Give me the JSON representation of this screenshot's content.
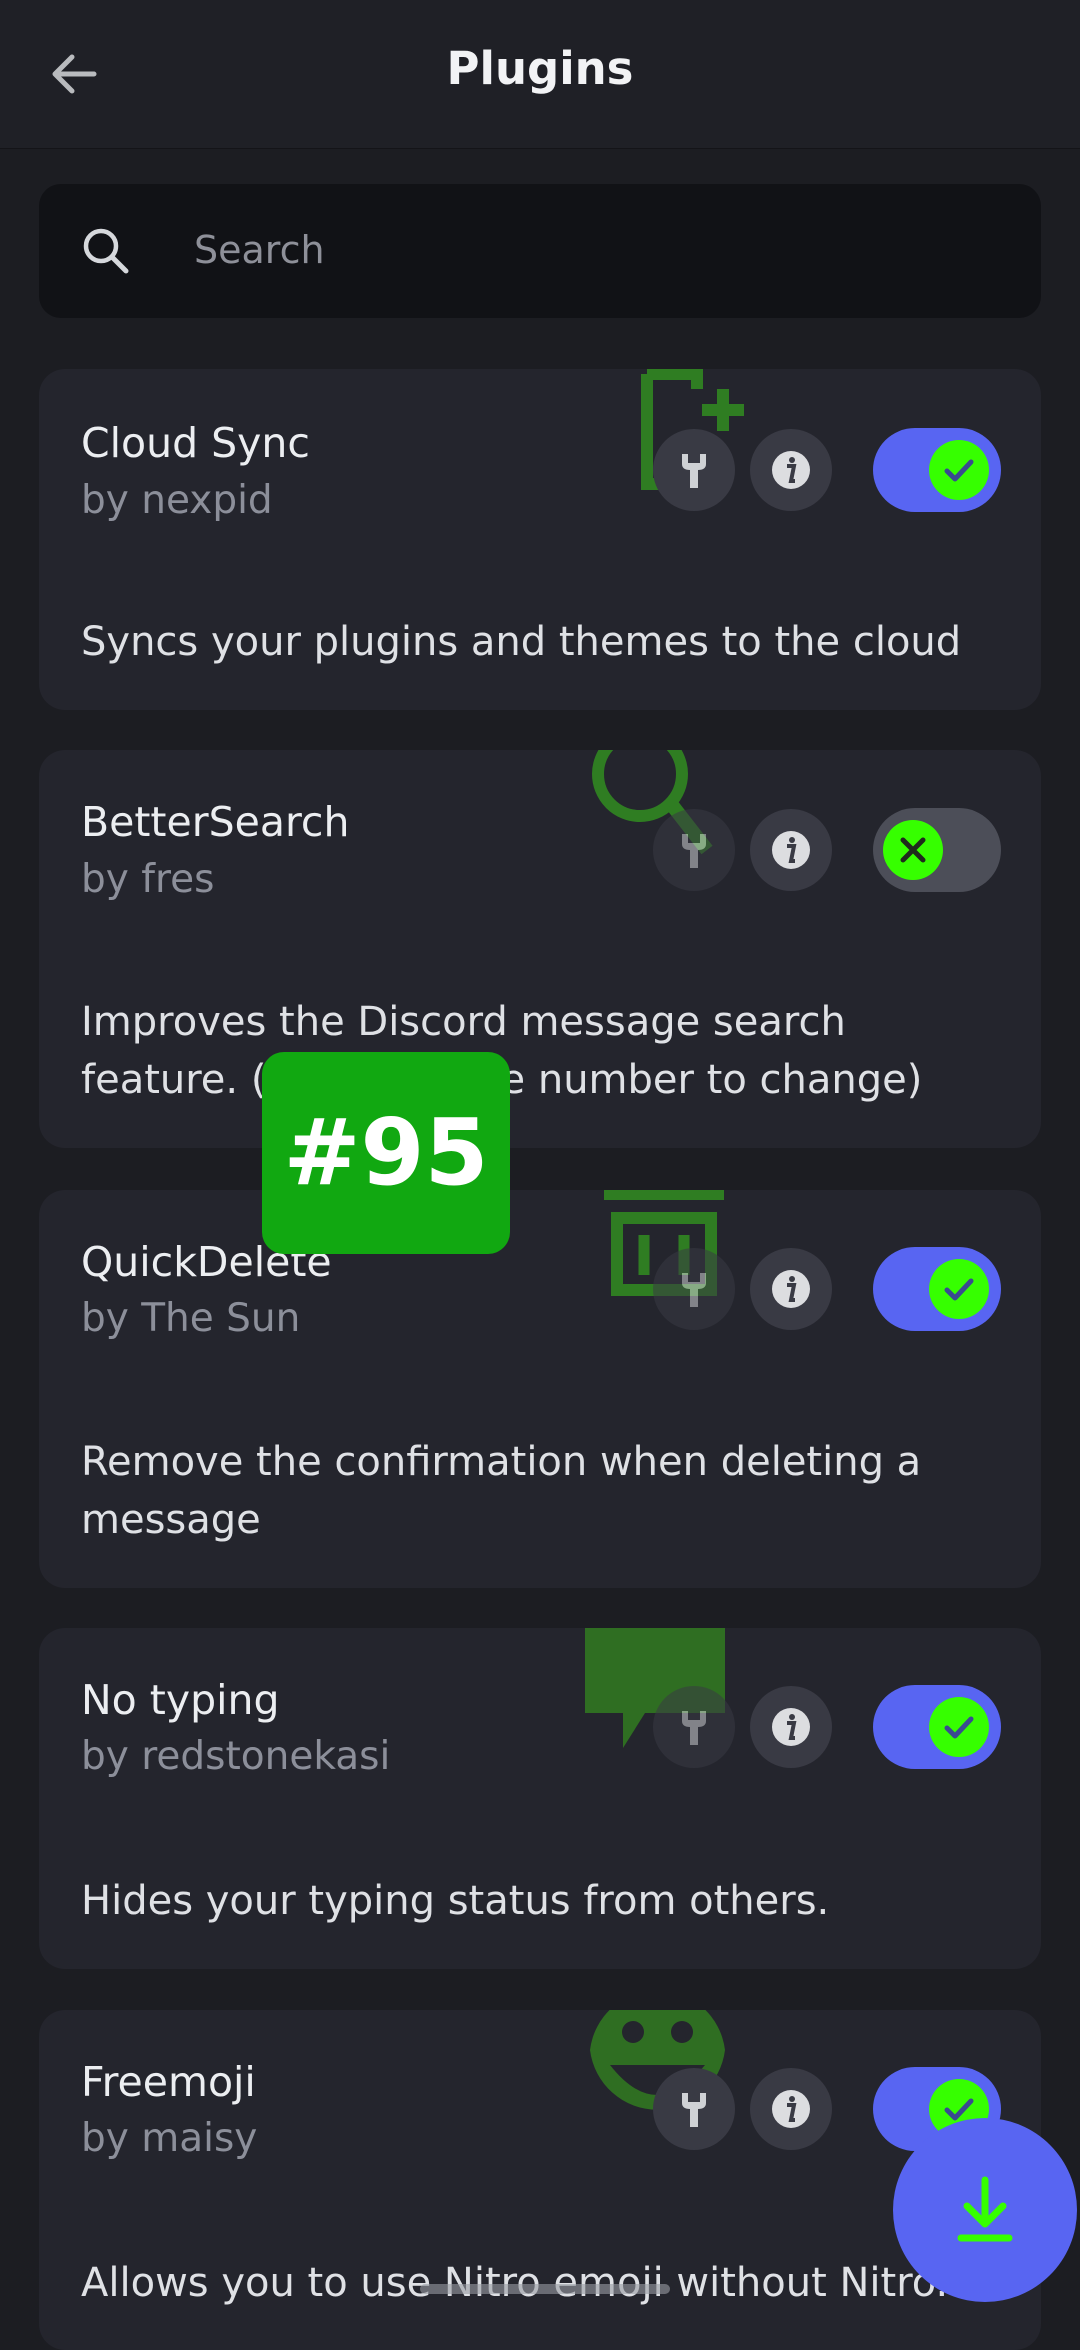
{
  "header": {
    "title": "Plugins",
    "back_icon": "arrow-left-icon"
  },
  "search": {
    "placeholder": "Search",
    "icon": "search-icon"
  },
  "plugins": [
    {
      "name": "Cloud Sync",
      "author": "by nexpid",
      "description": "Syncs your plugins and themes to the cloud",
      "enabled": true,
      "icon": "cloud-sync-icon"
    },
    {
      "name": "BetterSearch",
      "author": "by fres",
      "description": "Improves the Discord message search feature. (Tap the page number to change)",
      "enabled": false,
      "icon": "magnifier-icon"
    },
    {
      "name": "QuickDelete",
      "author": "by The Sun",
      "description": "Remove the confirmation when deleting a message",
      "enabled": true,
      "icon": "trash-icon"
    },
    {
      "name": "No typing",
      "author": "by redstonekasi",
      "description": "Hides your typing status from others.",
      "enabled": true,
      "icon": "chat-bubble-icon"
    },
    {
      "name": "Freemoji",
      "author": "by maisy",
      "description": "Allows you to use Nitro emoji without Nitro.",
      "enabled": true,
      "icon": "smiley-icon"
    }
  ],
  "overlay_badge": "#95",
  "fab": {
    "icon": "download-icon"
  },
  "colors": {
    "accent": "#5865f2",
    "knob": "#36ff00",
    "card": "#24252d",
    "background": "#1c1d22"
  }
}
